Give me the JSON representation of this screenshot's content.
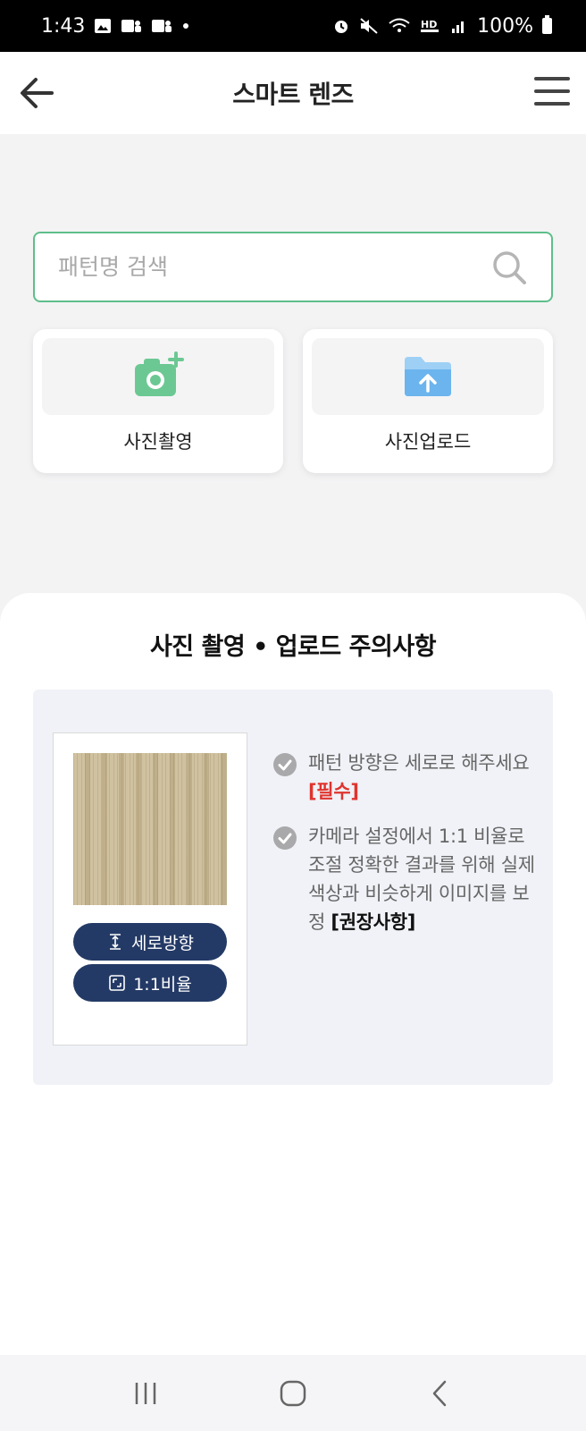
{
  "status_bar": {
    "time": "1:43",
    "battery": "100%"
  },
  "header": {
    "title": "스마트 렌즈",
    "back_icon": "arrow-left-icon",
    "menu_icon": "hamburger-menu-icon"
  },
  "search": {
    "placeholder": "패턴명 검색",
    "value": "",
    "icon": "search-icon"
  },
  "actions": [
    {
      "label": "사진촬영",
      "icon": "camera-plus-icon",
      "color": "#6cc893"
    },
    {
      "label": "사진업로드",
      "icon": "folder-upload-icon",
      "color": "#6cb4ee"
    }
  ],
  "notice": {
    "title": "사진 촬영 • 업로드 주의사항",
    "sample_tags": [
      {
        "label": "세로방향",
        "icon": "vertical-arrow-icon"
      },
      {
        "label": "1:1비율",
        "icon": "square-ratio-icon"
      }
    ],
    "items": [
      {
        "text": "패턴 방향은 세로로 해주세요 ",
        "tag": "[필수]"
      },
      {
        "text": "카메라 설정에서 1:1 비율로 조절 정확한 결과를 위해 실제 색상과 비슷하게 이미지를 보정 ",
        "tag": "[권장사항]"
      }
    ]
  },
  "colors": {
    "accent_green": "#5fbe8a",
    "pill_navy": "#243a66",
    "required_red": "#e0332e"
  }
}
